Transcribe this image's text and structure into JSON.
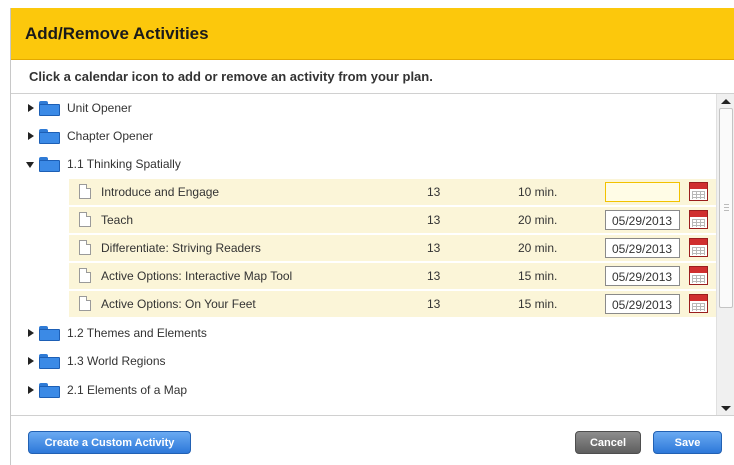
{
  "dialog": {
    "title": "Add/Remove Activities",
    "instruction": "Click a calendar icon to add or remove an activity from your plan."
  },
  "tree": {
    "top_items": [
      {
        "label": "Unit Opener",
        "expanded": false
      },
      {
        "label": "Chapter Opener",
        "expanded": false
      },
      {
        "label": "1.1  Thinking Spatially",
        "expanded": true
      }
    ],
    "activities": [
      {
        "name": "Introduce and Engage",
        "number": "13",
        "duration": "10 min.",
        "date": "",
        "date_highlight": true
      },
      {
        "name": "Teach",
        "number": "13",
        "duration": "20 min.",
        "date": "05/29/2013"
      },
      {
        "name": "Differentiate: Striving Readers",
        "number": "13",
        "duration": "20 min.",
        "date": "05/29/2013"
      },
      {
        "name": "Active Options: Interactive Map Tool",
        "number": "13",
        "duration": "15 min.",
        "date": "05/29/2013"
      },
      {
        "name": "Active Options: On Your Feet",
        "number": "13",
        "duration": "15 min.",
        "date": "05/29/2013"
      }
    ],
    "bottom_items": [
      {
        "label": "1.2  Themes and Elements",
        "expanded": false
      },
      {
        "label": "1.3  World Regions",
        "expanded": false
      },
      {
        "label": "2.1  Elements of a Map",
        "expanded": false
      }
    ]
  },
  "footer": {
    "create_custom_label": "Create a Custom Activity",
    "cancel_label": "Cancel",
    "save_label": "Save"
  },
  "colors": {
    "header_bg": "#fcc80c",
    "activity_row_bg": "#fbf5d8",
    "primary_button": "#2d78d9",
    "cancel_button": "#5e5e5e",
    "folder": "#3b8ae6",
    "calendar": "#d02f2f"
  },
  "icons": {
    "collapsed": "triangle-right-icon",
    "expanded": "triangle-down-icon",
    "folder": "folder-icon",
    "document": "document-icon",
    "calendar": "calendar-icon"
  }
}
